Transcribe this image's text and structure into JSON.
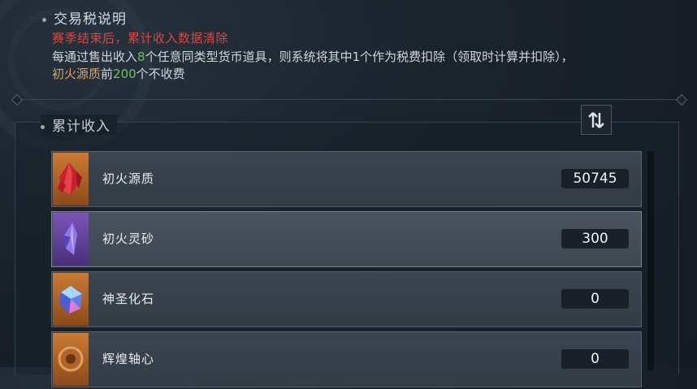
{
  "tax_section": {
    "title": "交易税说明",
    "warning": "赛季结束后，累计收入数据清除",
    "desc_p1": "每通过售出收入",
    "desc_num1": "8",
    "desc_p2": "个任意同类型货币道具，则系统将其中1个作为税费扣除（领取时计算并扣除），",
    "desc_item": "初火源质",
    "desc_p3": "前",
    "desc_num2": "200",
    "desc_p4": "个不收费"
  },
  "income_section": {
    "title": "累计收入",
    "items": [
      {
        "name": "初火源质",
        "value": "50745",
        "icon": "red-crystal-icon",
        "rarity_color": "#c97b35"
      },
      {
        "name": "初火灵砂",
        "value": "300",
        "icon": "purple-crystal-icon",
        "rarity_color": "#7b55b8"
      },
      {
        "name": "神圣化石",
        "value": "0",
        "icon": "prism-stone-icon",
        "rarity_color": "#c97b35"
      },
      {
        "name": "辉煌轴心",
        "value": "0",
        "icon": "bronze-axis-icon",
        "rarity_color": "#c97b35"
      }
    ]
  },
  "colors": {
    "warning": "#d9473e",
    "highlight_green": "#6dc34f",
    "highlight_orange": "#e0a255"
  }
}
